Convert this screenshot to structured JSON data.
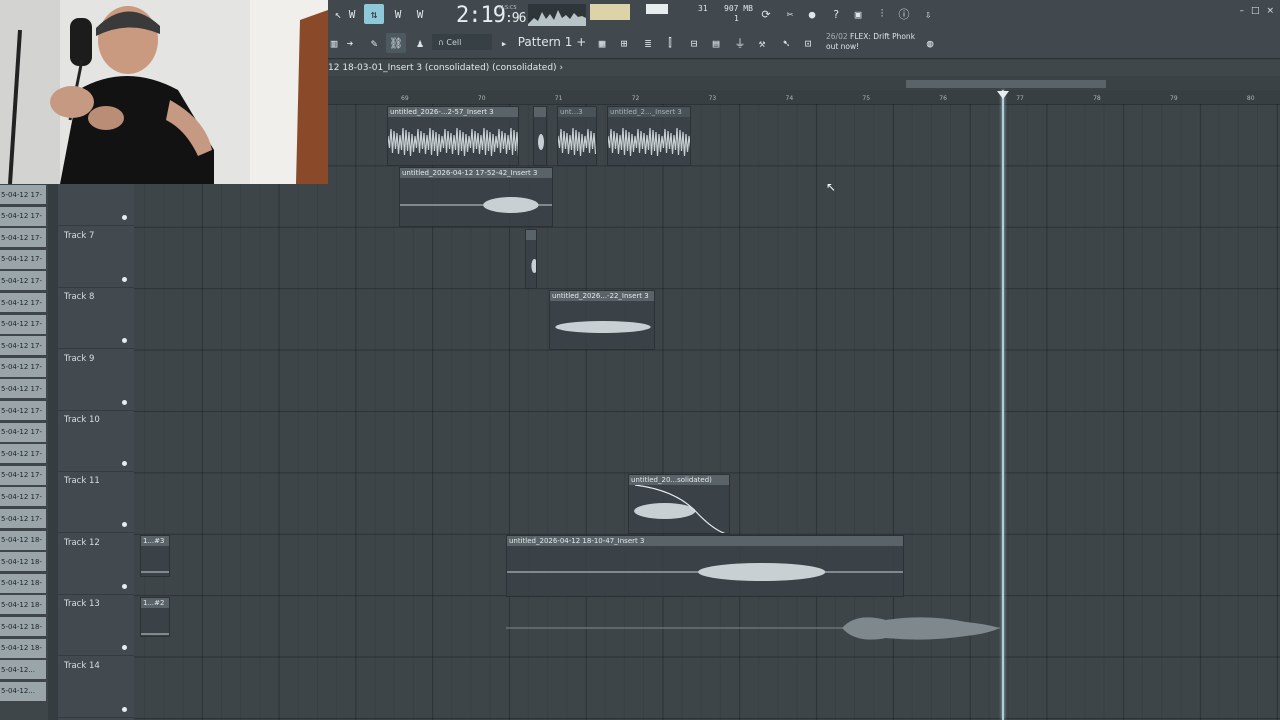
{
  "toolbar": {
    "time": "2:19",
    "time_frac": ":96",
    "time_label": "M:S:CS",
    "bpm_top": "31",
    "mem": "907 MB",
    "mem_sub": "1",
    "cell_label": "Cell",
    "pattern_label": "Pattern 1",
    "news_date": "26/02",
    "news_line1": "FLEX: Drift Phonk",
    "news_line2": "out now!",
    "buttons_left": [
      "W",
      "W",
      "W",
      "W"
    ],
    "window_controls": [
      "–",
      "□",
      "×"
    ]
  },
  "playlist": {
    "title": "12 18-03-01_Insert 3 (consolidated) (consolidated)",
    "bar_numbers": [
      "69",
      "70",
      "71",
      "72",
      "73",
      "74",
      "75",
      "76",
      "77",
      "78",
      "79",
      "80"
    ]
  },
  "browser": {
    "items": [
      "5-04-12 17-",
      "5-04-12 17-",
      "5-04-12 17-",
      "5-04-12 17-",
      "5-04-12 17-",
      "5-04-12 17-",
      "5-04-12 17-",
      "5-04-12 17-",
      "5-04-12 17-",
      "5-04-12 17-",
      "5-04-12 17-",
      "5-04-12 17-",
      "5-04-12 17-",
      "5-04-12 17-",
      "5-04-12 17-",
      "5-04-12 17-",
      "5-04-12 18-",
      "5-04-12 18-",
      "5-04-12 18-",
      "5-04-12 18-",
      "5-04-12 18-",
      "5-04-12 18-",
      "5-04-12...",
      "5-04-12..."
    ]
  },
  "tracks": [
    {
      "name": ""
    },
    {
      "name": ""
    },
    {
      "name": "Track 7"
    },
    {
      "name": "Track 8"
    },
    {
      "name": "Track 9"
    },
    {
      "name": "Track 10"
    },
    {
      "name": "Track 11"
    },
    {
      "name": "Track 12"
    },
    {
      "name": "Track 13"
    },
    {
      "name": "Track 14"
    }
  ],
  "clips": [
    {
      "label": "untitled_2026-...2-57_Insert 3"
    },
    {
      "label": ""
    },
    {
      "label": "unt...3"
    },
    {
      "label": "untitled_2..._Insert 3"
    },
    {
      "label": "untitled_2026-04-12 17-52-42_Insert 3"
    },
    {
      "label": ""
    },
    {
      "label": "untitled_2026...-22_Insert 3"
    },
    {
      "label": "untitled_20...solidated)"
    },
    {
      "label": "1...#3"
    },
    {
      "label": "untitled_2026-04-12 18-10-47_Insert 3"
    },
    {
      "label": "1...#2"
    }
  ]
}
